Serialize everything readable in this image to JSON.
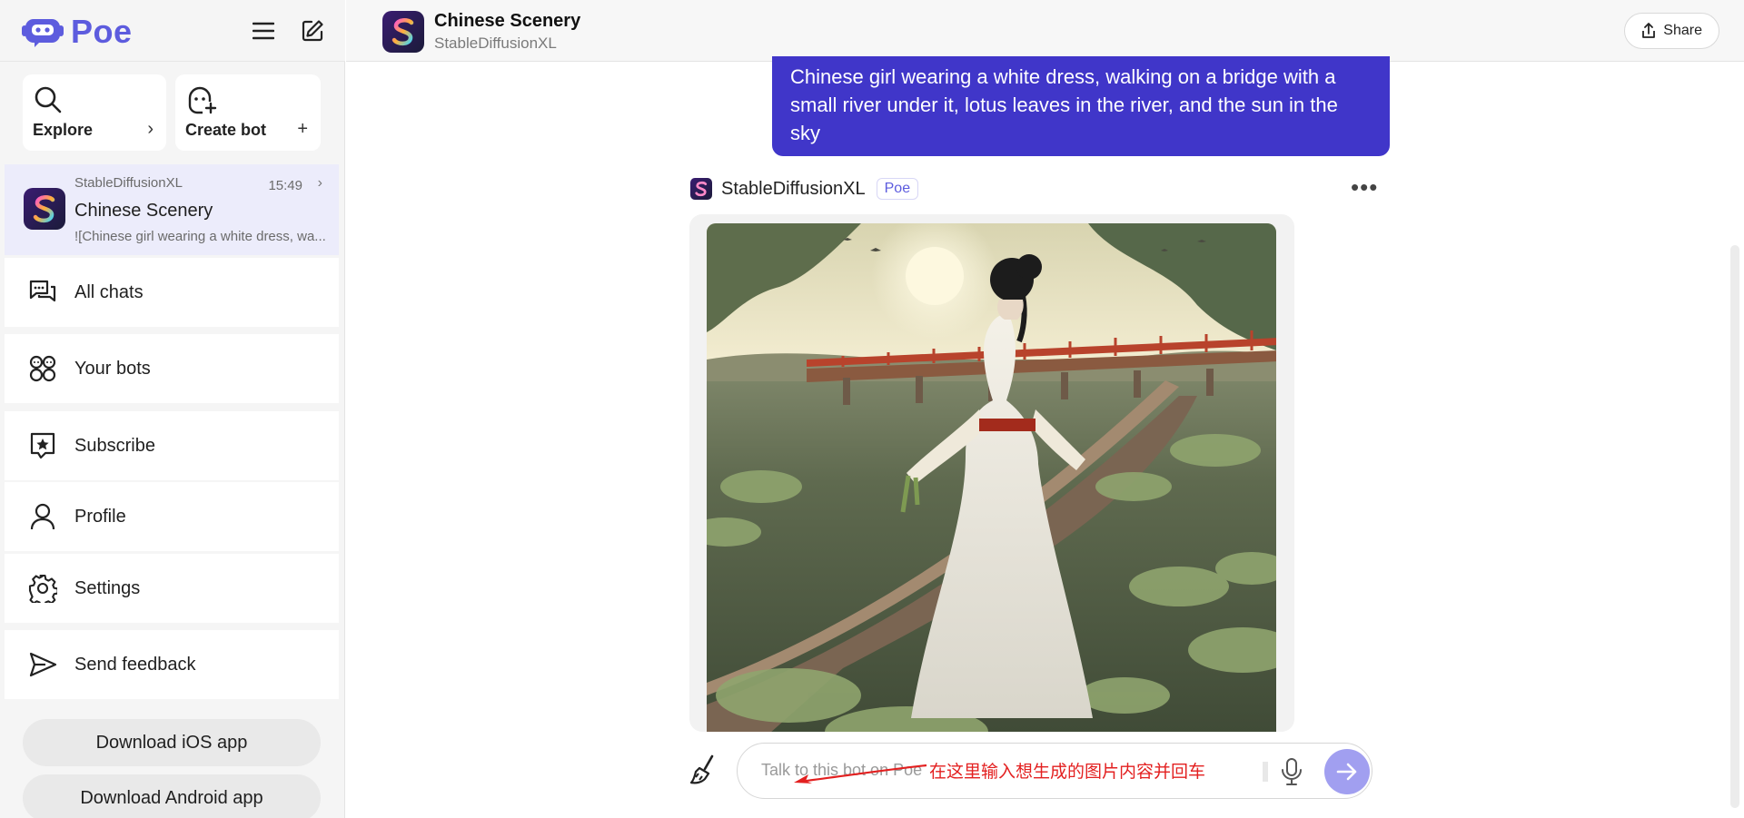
{
  "sidebar": {
    "logo_text": "Poe",
    "tiles": {
      "explore": "Explore",
      "create_bot": "Create bot",
      "explore_arrow": "›",
      "create_plus": "+"
    },
    "active_chat": {
      "bot": "StableDiffusionXL",
      "time": "15:49",
      "title": "Chinese Scenery",
      "snippet": "![Chinese girl wearing a white dress, wa..."
    },
    "nav": {
      "all_chats": "All chats",
      "your_bots": "Your bots",
      "subscribe": "Subscribe",
      "profile": "Profile",
      "settings": "Settings",
      "send_feedback": "Send feedback"
    },
    "download_ios": "Download iOS app",
    "download_android": "Download Android app"
  },
  "header": {
    "title": "Chinese Scenery",
    "subtitle": "StableDiffusionXL",
    "share": "Share"
  },
  "conversation": {
    "user_message": "Chinese girl wearing a white dress, walking on a bridge with a small river under it, lotus leaves in the river, and the sun in the sky",
    "bot_name": "StableDiffusionXL",
    "bot_badge": "Poe",
    "more": "•••"
  },
  "composer": {
    "placeholder": "Talk to this bot on Poe",
    "annotation": "在这里输入想生成的图片内容并回车"
  },
  "colors": {
    "brand": "#5d5cde",
    "user_bubble": "#4036c9",
    "send_button": "#a19ff0",
    "annotation": "#e32020"
  }
}
